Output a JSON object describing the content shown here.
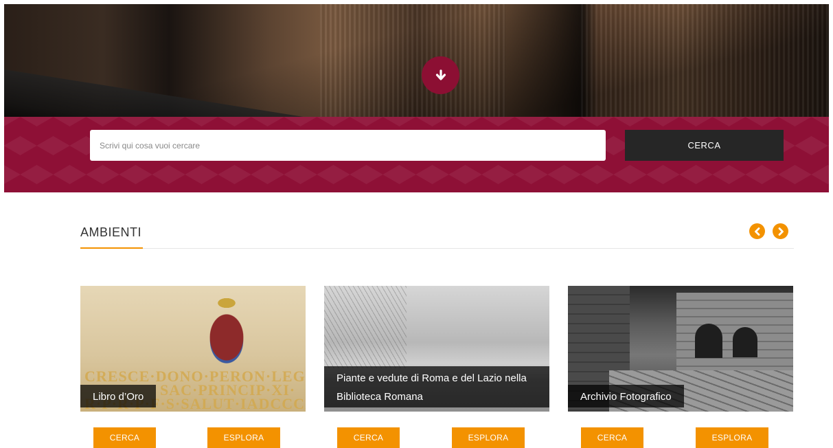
{
  "search": {
    "placeholder": "Scrivi qui cosa vuoi cercare",
    "button_label": "CERCA"
  },
  "section": {
    "title": "AMBIENTI"
  },
  "cards": [
    {
      "caption": "Libro d’Oro",
      "inscription_lines": [
        "CRESCE·DONO·PERON·LEGAX",
        "SAC·PRINCIP·XI·",
        "R·P·R·P·F·S·SALUT·IADCCCXLII"
      ],
      "search_label": "CERCA",
      "explore_label": "ESPLORA"
    },
    {
      "caption": "Piante e vedute di Roma e del Lazio nella Biblioteca Romana",
      "search_label": "CERCA",
      "explore_label": "ESPLORA"
    },
    {
      "caption": "Archivio Fotografico",
      "search_label": "CERCA",
      "explore_label": "ESPLORA"
    }
  ],
  "colors": {
    "accent": "#f39200",
    "brand": "#8e1036",
    "dark": "#262626"
  },
  "icons": {
    "scroll_down": "arrow-down-icon",
    "prev": "chevron-left-icon",
    "next": "chevron-right-icon"
  }
}
